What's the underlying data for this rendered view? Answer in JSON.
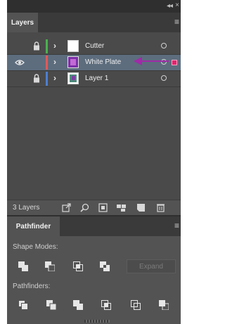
{
  "tabs": {
    "layers": "Layers",
    "pathfinder": "Pathfinder"
  },
  "layers": [
    {
      "name": "Cutter",
      "color": "#4caf50",
      "visible": false,
      "locked": true,
      "selected": false,
      "thumb": "blank"
    },
    {
      "name": "White Plate",
      "color": "#e05a5a",
      "visible": true,
      "locked": false,
      "selected": true,
      "thumb": "purple"
    },
    {
      "name": "Layer 1",
      "color": "#4d7fd0",
      "visible": false,
      "locked": true,
      "selected": false,
      "thumb": "art"
    }
  ],
  "footer": {
    "count": "3 Layers",
    "icons": [
      "export-icon",
      "locate-object-icon",
      "make-clipping-mask-icon",
      "create-sublayer-icon",
      "new-layer-icon",
      "delete-icon"
    ]
  },
  "pathfinder": {
    "shape_modes_label": "Shape Modes:",
    "pathfinders_label": "Pathfinders:",
    "expand_label": "Expand",
    "shape_mode_icons": [
      "unite-icon",
      "minus-front-icon",
      "intersect-icon",
      "exclude-icon"
    ],
    "pathfinder_icons": [
      "divide-icon",
      "trim-icon",
      "merge-icon",
      "crop-icon",
      "outline-icon",
      "minus-back-icon"
    ]
  },
  "colors": {
    "annotation_arrow": "#a02aa8",
    "selection_square": "#e0246e"
  }
}
